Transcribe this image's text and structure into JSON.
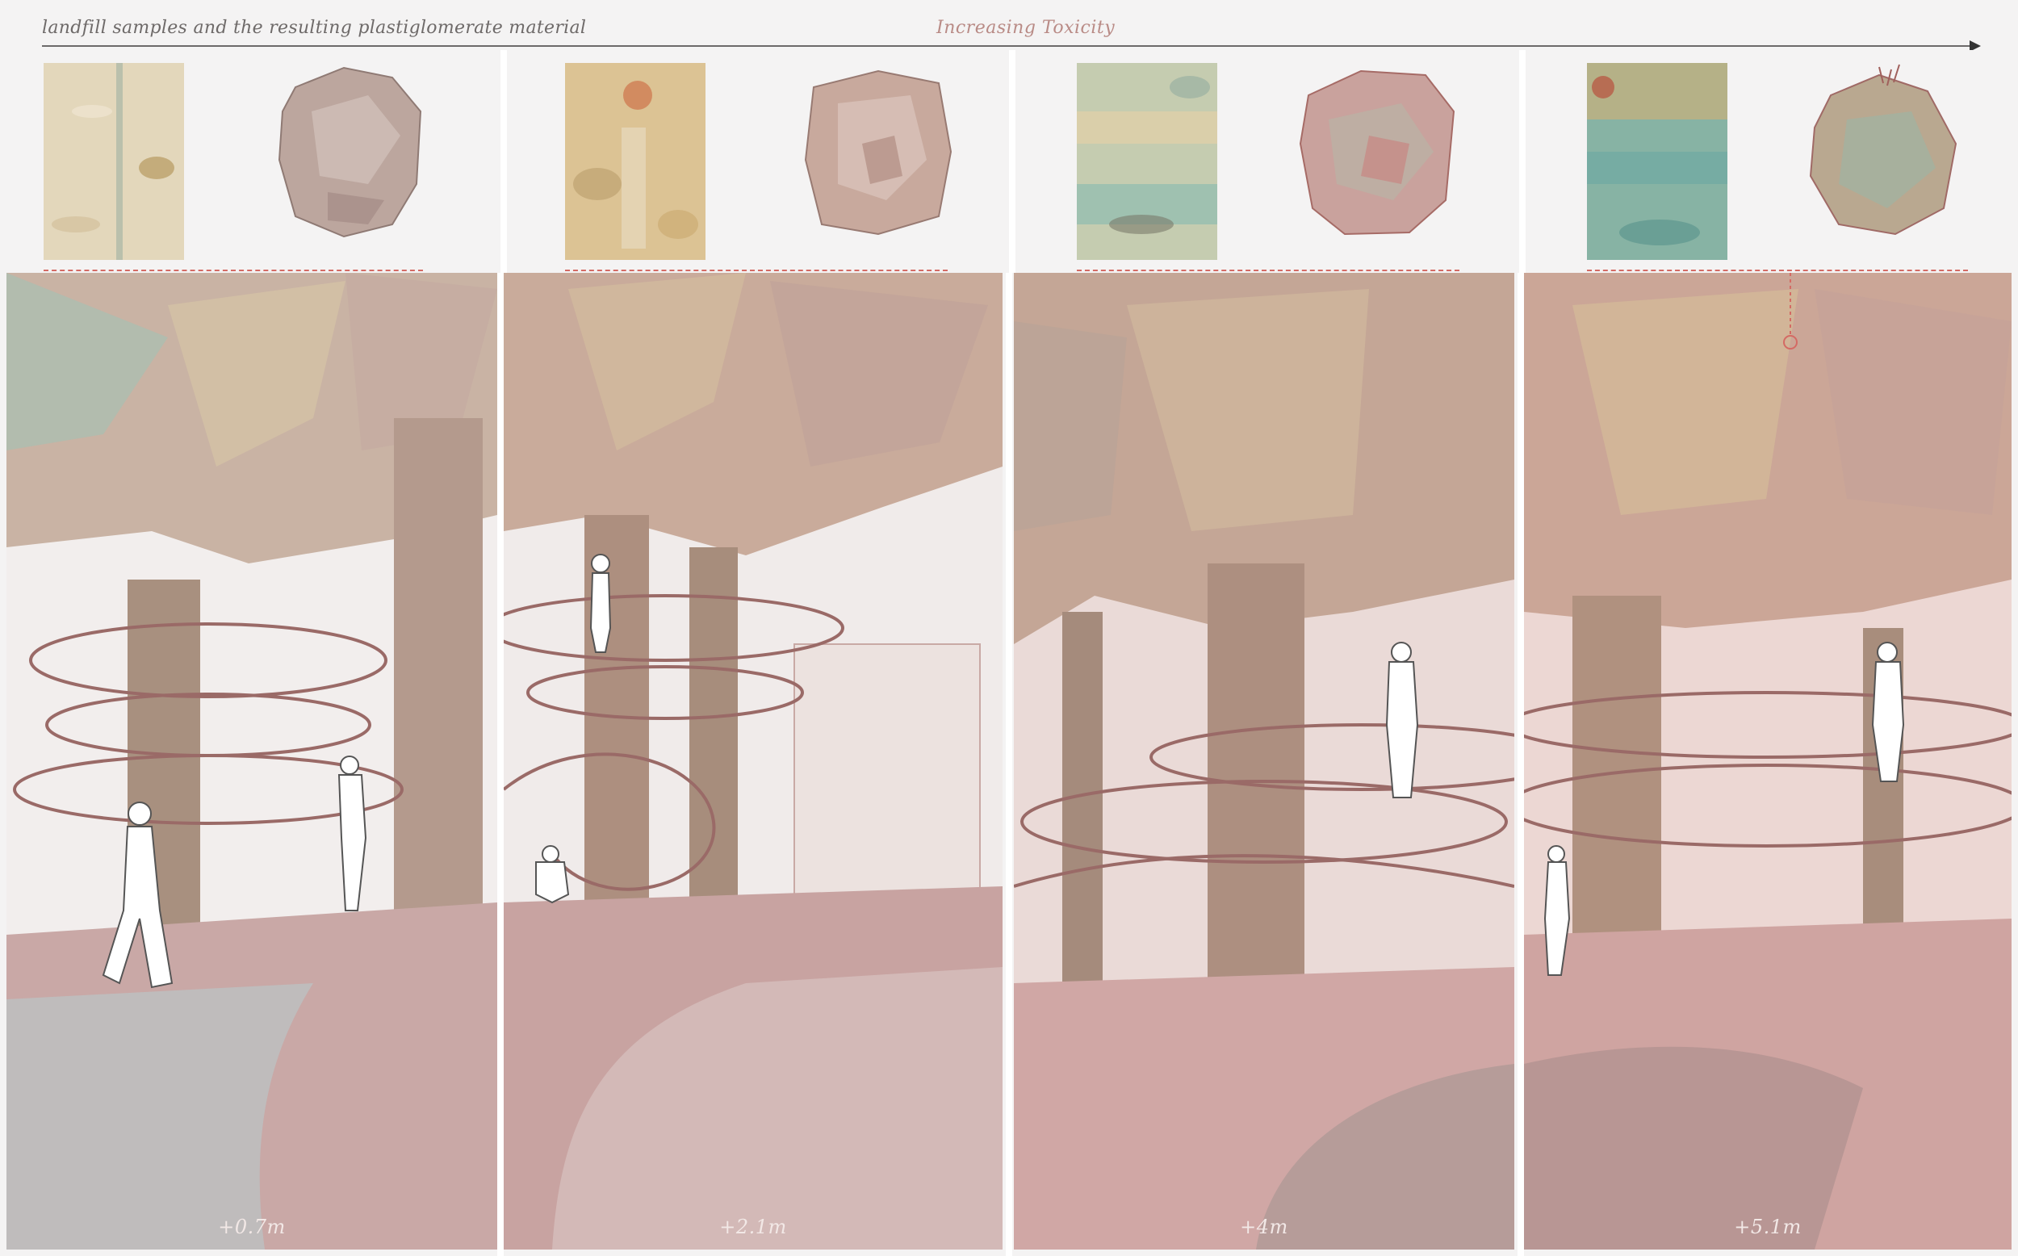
{
  "header": {
    "caption_left": "landfill samples and the resulting plastiglomerate material",
    "caption_center": "Increasing Toxicity"
  },
  "samples": [
    {
      "texture_color": "#e2d5b6",
      "rock_color": "#bfa9a0"
    },
    {
      "texture_color": "#dcc08f",
      "rock_color": "#c7a79b"
    },
    {
      "texture_color": "#b9c7ad",
      "rock_color": "#c79c98"
    },
    {
      "texture_color": "#7fb0a4",
      "rock_color": "#b3a58f"
    }
  ],
  "panels": [
    {
      "level": "+0.7m",
      "canopy_color": "#c8b2a3",
      "floor_color": "#c9a8a6"
    },
    {
      "level": "+2.1m",
      "canopy_color": "#c9ab9b",
      "floor_color": "#c8a3a1"
    },
    {
      "level": "+4m",
      "canopy_color": "#c4a696",
      "floor_color": "#d0a7a5"
    },
    {
      "level": "+5.1m",
      "canopy_color": "#cba697",
      "floor_color": "#cfa4a1"
    }
  ],
  "colors": {
    "accent_dash": "#d46a64",
    "rail": "#9a6a67",
    "figure_fill": "#ffffff"
  }
}
